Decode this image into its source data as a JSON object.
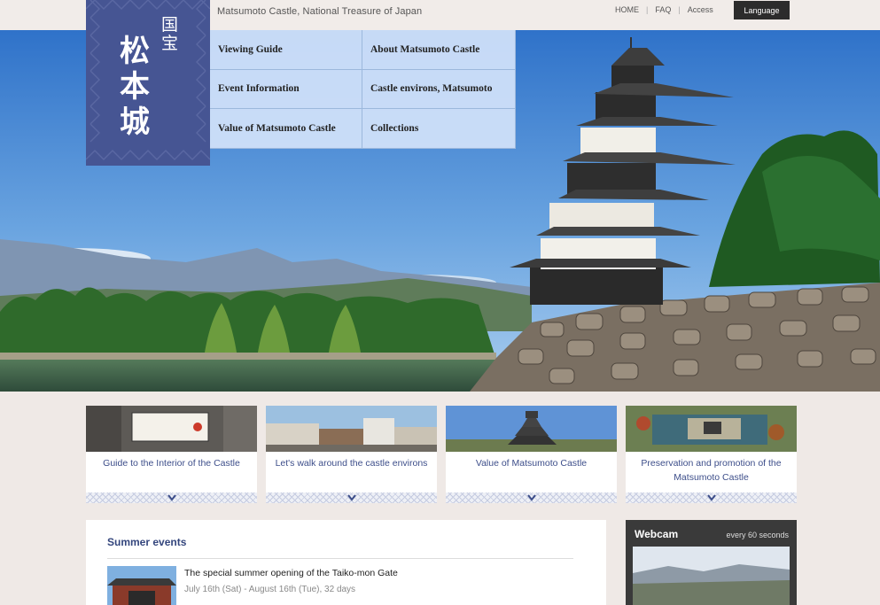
{
  "header": {
    "tagline": "Matsumoto Castle, National Treasure of Japan",
    "links": [
      "HOME",
      "FAQ",
      "Access"
    ],
    "language_label": "Language"
  },
  "logo": {
    "small": "国宝",
    "big": "松本城"
  },
  "nav": {
    "items": [
      "Viewing Guide",
      "About Matsumoto Castle",
      "Event Information",
      "Castle environs, Matsumoto",
      "Value of Matsumoto Castle",
      "Collections"
    ]
  },
  "cards": [
    {
      "title": "Guide to the Interior of the Castle"
    },
    {
      "title": "Let's walk around the castle environs"
    },
    {
      "title": "Value of Matsumoto Castle"
    },
    {
      "title": "Preservation and promotion of the Matsumoto Castle"
    }
  ],
  "events": {
    "heading": "Summer events",
    "items": [
      {
        "title": "The special summer opening of the Taiko-mon Gate",
        "date": "July 16th (Sat) - August 16th (Tue), 32 days"
      }
    ]
  },
  "webcam": {
    "title": "Webcam",
    "interval": "every 60 seconds"
  },
  "colors": {
    "brand_navy": "#465593",
    "link_blue": "#3d4e8a",
    "nav_bg": "#d2e2fa"
  }
}
